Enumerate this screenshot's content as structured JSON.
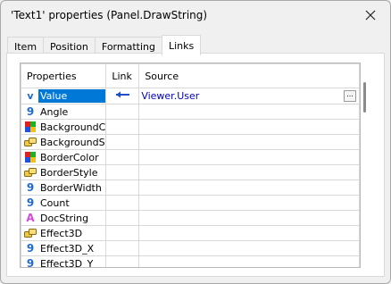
{
  "window": {
    "title": "'Text1' properties (Panel.DrawString)"
  },
  "tabs": [
    {
      "label": "Item",
      "active": false
    },
    {
      "label": "Position",
      "active": false
    },
    {
      "label": "Formatting",
      "active": false
    },
    {
      "label": "Links",
      "active": true
    }
  ],
  "grid": {
    "columns": {
      "properties": "Properties",
      "link": "Link",
      "source": "Source"
    },
    "rows": [
      {
        "name": "Value",
        "icon": "value-icon",
        "link": "arrow-left-icon",
        "source": "Viewer.User",
        "selected": true
      },
      {
        "name": "Angle",
        "icon": "numeric-icon",
        "link": "",
        "source": ""
      },
      {
        "name": "BackgroundC",
        "icon": "color-icon",
        "link": "",
        "source": ""
      },
      {
        "name": "BackgroundS",
        "icon": "enum-icon",
        "link": "",
        "source": ""
      },
      {
        "name": "BorderColor",
        "icon": "color-icon",
        "link": "",
        "source": ""
      },
      {
        "name": "BorderStyle",
        "icon": "enum-icon",
        "link": "",
        "source": ""
      },
      {
        "name": "BorderWidth",
        "icon": "numeric-icon",
        "link": "",
        "source": ""
      },
      {
        "name": "Count",
        "icon": "numeric-icon",
        "link": "",
        "source": ""
      },
      {
        "name": "DocString",
        "icon": "string-icon",
        "link": "",
        "source": ""
      },
      {
        "name": "Effect3D",
        "icon": "enum-icon",
        "link": "",
        "source": ""
      },
      {
        "name": "Effect3D_X",
        "icon": "numeric-icon",
        "link": "",
        "source": ""
      },
      {
        "name": "Effect3D_Y",
        "icon": "numeric-icon",
        "link": "",
        "source": ""
      }
    ]
  },
  "colors": {
    "selection": "#0078d7",
    "link_text": "#0000c8",
    "numeric_icon": "#1e6ad4",
    "string_icon": "#d24adb"
  }
}
